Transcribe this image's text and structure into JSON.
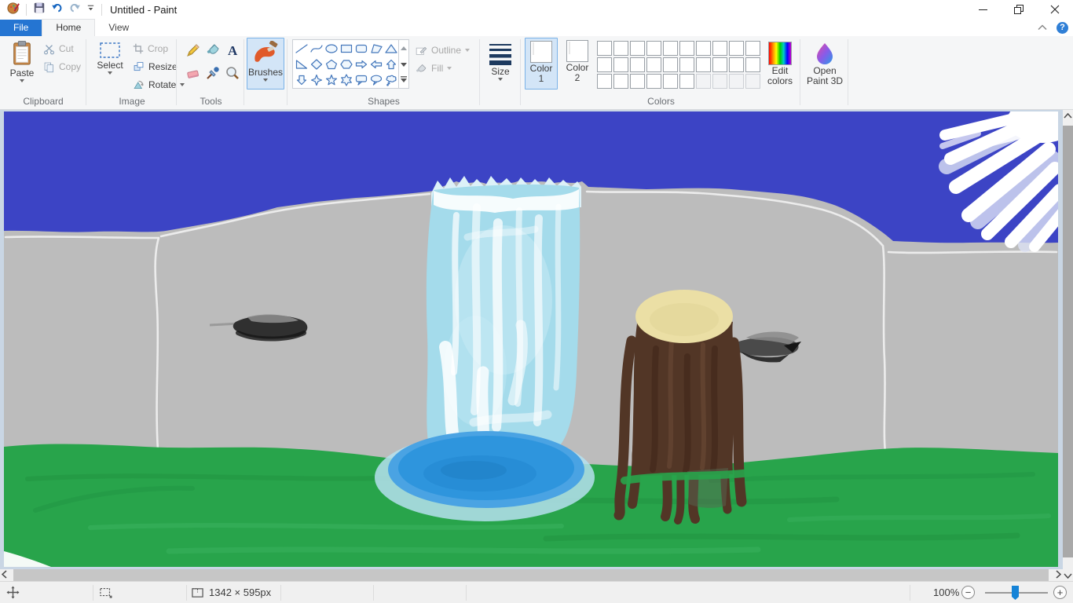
{
  "window": {
    "title": "Untitled - Paint",
    "help_glyph": "?"
  },
  "tabs": {
    "file": "File",
    "home": "Home",
    "view": "View"
  },
  "ribbon": {
    "clipboard": {
      "group_label": "Clipboard",
      "paste": "Paste",
      "cut": "Cut",
      "copy": "Copy"
    },
    "image": {
      "group_label": "Image",
      "select": "Select",
      "crop": "Crop",
      "resize": "Resize",
      "rotate": "Rotate"
    },
    "tools": {
      "group_label": "Tools"
    },
    "brushes": {
      "label": "Brushes"
    },
    "shapes": {
      "group_label": "Shapes",
      "outline": "Outline",
      "fill": "Fill",
      "items": [
        "line",
        "curve",
        "oval",
        "rectangle",
        "rounded-rectangle",
        "polygon",
        "triangle",
        "right-triangle",
        "diamond",
        "pentagon",
        "hexagon",
        "right-arrow",
        "left-arrow",
        "up-arrow",
        "down-arrow",
        "four-point-star",
        "five-point-star",
        "six-point-star",
        "rounded-rectangle-callout",
        "oval-callout",
        "cloud-callout"
      ]
    },
    "size": {
      "label": "Size"
    },
    "colors": {
      "group_label": "Colors",
      "color1_label": "Color",
      "color1_num": "1",
      "color1_value": "#FFFFFF",
      "color2_label": "Color",
      "color2_num": "2",
      "color2_value": "#FFFFFF",
      "palette": [
        [
          "#000000",
          "#7F7F7F",
          "#880015",
          "#ED1C24",
          "#FF7F27",
          "#FFF200",
          "#22B14C",
          "#00A2E8",
          "#3F48CC",
          "#A349A4"
        ],
        [
          "#FFFFFF",
          "#C3C3C3",
          "#B97A57",
          "#FFAEC9",
          "#FFC90E",
          "#EFE4B0",
          "#B5E61D",
          "#99D9EA",
          "#7092BE",
          "#C8BFE7"
        ],
        [
          "#4E3220",
          "#4C4C4C",
          "#6E6E6E",
          "#1F1F1F",
          "#C9C9C9",
          "#FFFFFF"
        ]
      ],
      "empty_slots": 4,
      "edit_colors_line1": "Edit",
      "edit_colors_line2": "colors"
    },
    "paint3d": {
      "line1": "Open",
      "line2": "Paint 3D"
    }
  },
  "status_bar": {
    "image_size": "1342 × 595px",
    "zoom_percent": "100%"
  },
  "ui": {
    "accent": "#2575d2",
    "selected_fill": "#d3e5f7",
    "selected_border": "#7ab2e8",
    "workspace_bg": "#c9d6e4"
  },
  "painting": {
    "sky": "#3c44c5",
    "cliff": "#bcbcbc",
    "cliff_outline": "#ececec",
    "waterfall": "#a4dbeb",
    "waterfall_light": "#ddf1f8",
    "waterfall_inner": "#c6eaf4",
    "white": "#ffffff",
    "mist": "#b5e0ee",
    "pool_rim": "#4aa3e3",
    "pool": "#2e95dd",
    "pool_dark": "#2387cf",
    "pool_deep": "#1e7ec2",
    "grass": "#28a44b",
    "grass_dark": "#1f9140",
    "grass_light": "#3cb462",
    "stump": "#523626",
    "stump_dark": "#3b2216",
    "stump_light": "#6f4d38",
    "stump_top": "#ebdfa5",
    "stump_top_shade": "#dccf92",
    "stump_shadow": "#55654f",
    "bird_dark": "#303030",
    "bird_mid": "#4a4a4a",
    "bird_light": "#8b8b8b",
    "bird_black": "#161616",
    "sun": "#ffffff",
    "sun_tint": "#dde2f5"
  }
}
